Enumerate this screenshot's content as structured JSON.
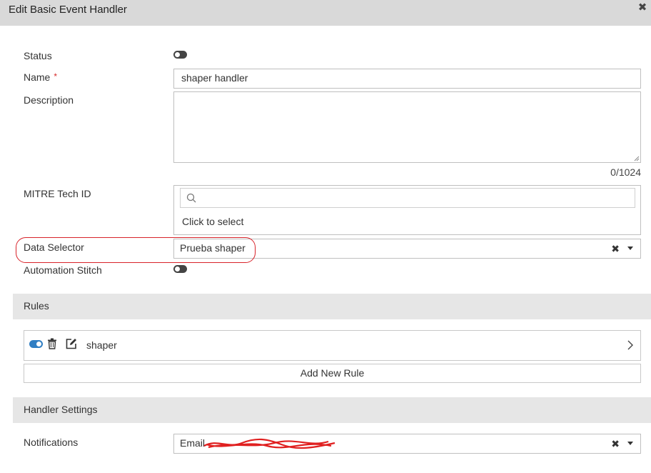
{
  "dialog": {
    "title": "Edit Basic Event Handler",
    "close_icon": "close-icon"
  },
  "form": {
    "status_label": "Status",
    "name_label": "Name",
    "name_required_mark": "*",
    "name_value": "shaper handler",
    "description_label": "Description",
    "description_value": "",
    "description_counter": "0/1024",
    "mitre_label": "MITRE Tech ID",
    "mitre_search_placeholder": "",
    "mitre_click_text": "Click to select",
    "data_selector_label": "Data Selector",
    "data_selector_value": "Prueba shaper",
    "automation_stitch_label": "Automation Stitch"
  },
  "rules": {
    "section_title": "Rules",
    "items": [
      {
        "name": "shaper",
        "enabled": true
      }
    ],
    "add_label": "Add New Rule"
  },
  "handler_settings": {
    "section_title": "Handler Settings",
    "notifications_label": "Notifications",
    "notifications_value": "Email"
  },
  "colors": {
    "toggle_on": "#2f7ec3",
    "annotation": "#d8232a",
    "required": "#d62a2a"
  }
}
